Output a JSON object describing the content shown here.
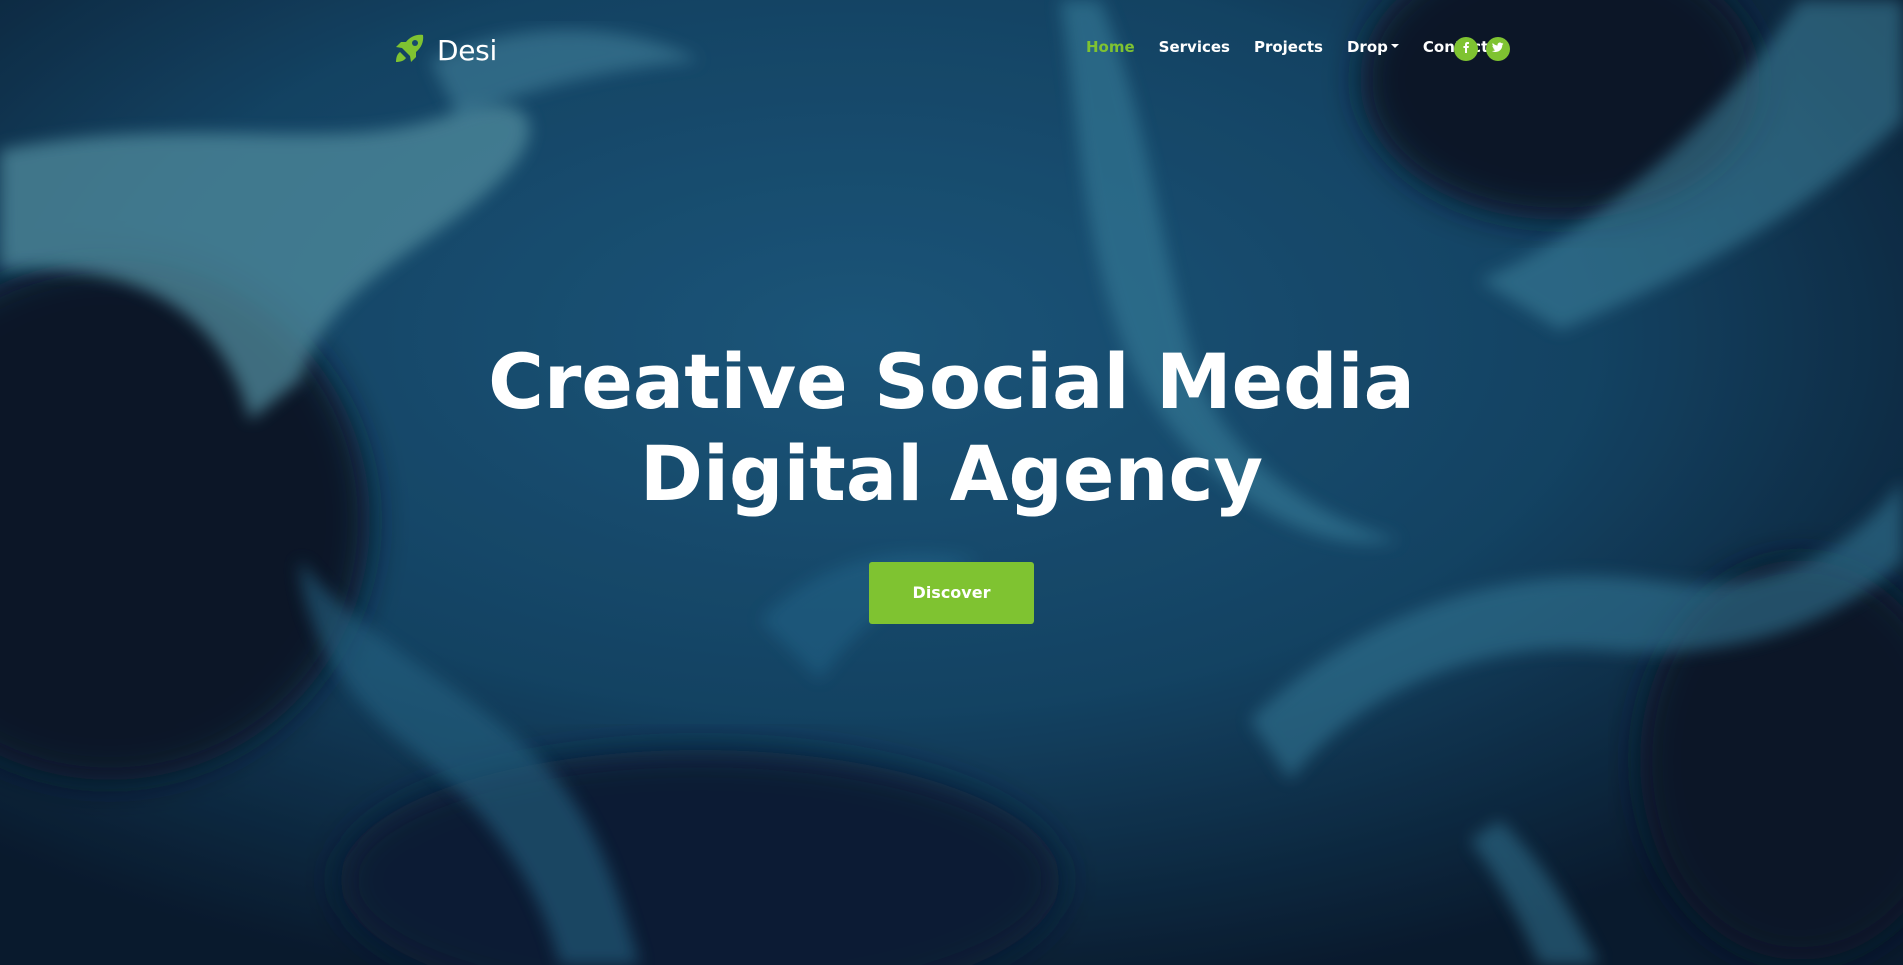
{
  "brand": {
    "name": "Desi",
    "logo_icon": "rocket-icon",
    "logo_color": "#7fc331"
  },
  "nav": {
    "items": [
      {
        "label": "Home",
        "active": true
      },
      {
        "label": "Services",
        "active": false
      },
      {
        "label": "Projects",
        "active": false
      },
      {
        "label": "Drop",
        "active": false,
        "dropdown": true
      },
      {
        "label": "Contact",
        "active": false
      }
    ],
    "social": [
      {
        "icon": "facebook-icon"
      },
      {
        "icon": "twitter-icon"
      }
    ]
  },
  "hero": {
    "title_line1": "Creative Social Media",
    "title_line2": "Digital Agency",
    "cta_label": "Discover"
  },
  "colors": {
    "accent": "#7fc331",
    "text": "#ffffff",
    "background_dark": "#0b1a2e",
    "background_mid": "#1d5e85",
    "background_light": "#3b8fae"
  }
}
